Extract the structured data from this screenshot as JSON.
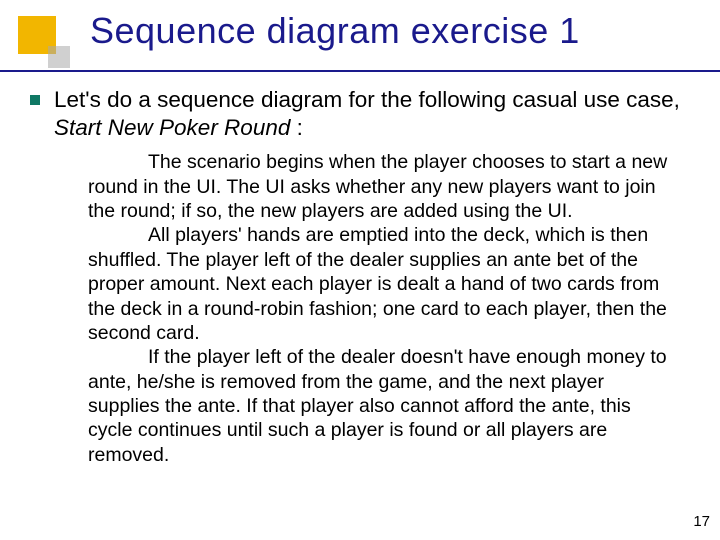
{
  "title": "Sequence diagram exercise 1",
  "lead": {
    "pre": "Let's do a sequence diagram for the following casual use case, ",
    "ital": "Start New Poker Round",
    "post": " :"
  },
  "paragraphs": [
    "The scenario begins when the player chooses to start a new round in the UI.  The UI asks whether any new players want to join the round; if so, the new players are added using the UI.",
    "All players' hands are emptied into the deck, which is then shuffled.  The player left of the dealer supplies an ante bet of the proper amount.  Next each player is dealt a hand of two cards from the deck in a round-robin fashion; one card to each player, then the second card.",
    "If the player left of the dealer doesn't have enough money to ante, he/she is removed from the game, and the next player supplies the ante.  If that player also cannot afford the ante, this cycle continues until such a player is found or all players are removed."
  ],
  "page_number": "17"
}
